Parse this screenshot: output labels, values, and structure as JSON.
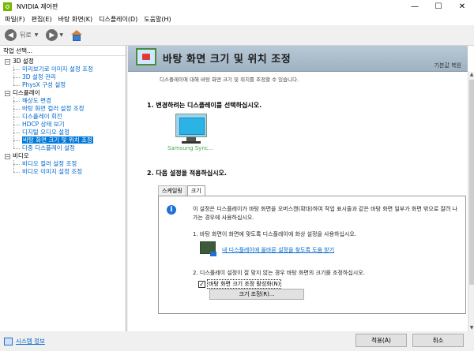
{
  "window": {
    "title": "NVIDIA 제어판",
    "controls": [
      "—",
      "☐",
      "✕"
    ]
  },
  "menu": [
    "파일(F)",
    "편집(E)",
    "바탕 화면(K)",
    "디스플레이(D)",
    "도움말(H)"
  ],
  "toolbar": {
    "back_label": "뒤로"
  },
  "sidebar": {
    "header": "작업 선택...",
    "categories": [
      {
        "label": "3D 설정",
        "toggle": "−",
        "items": [
          "미리보기로 이미지 설정 조정",
          "3D 설정 관리",
          "PhysX 구성 설정"
        ]
      },
      {
        "label": "디스플레이",
        "toggle": "−",
        "items": [
          "해상도 변경",
          "바탕 화면 컬러 설정 조정",
          "디스플레이 회전",
          "HDCP 상태 보기",
          "디지털 오디오 설정",
          "바탕 화면 크기 및 위치 조정",
          "다중 디스플레이 설정"
        ]
      },
      {
        "label": "비디오",
        "toggle": "−",
        "items": [
          "비디오 컬러 설정 조정",
          "비디오 이미지 설정 조정"
        ]
      }
    ],
    "selected": "바탕 화면 크기 및 위치 조정"
  },
  "system_info": "시스템 정보",
  "main": {
    "title": "바탕 화면 크기 및 위치 조정",
    "restore": "기본값 복원",
    "description": "디스플레이에 대해 바탕 화면 크기 및 위치를 조정할 수 있습니다.",
    "section1": "1. 변경하려는 디스플레이를 선택하십시오.",
    "display_name": "Samsung Sync...",
    "section2": "2. 다음 설정을 적용하십시오.",
    "tabs": [
      "스케일링",
      "크기"
    ],
    "active_tab": "크기",
    "info_text": "이 설정은 디스플레이가 바탕 화면을 오버스캔(확대)하여 작업 표시줄과 같은 바탕 화면 일부가 화면 밖으로 잘려 나가는 경우에 사용하십시오.",
    "step1": "1. 바탕 화면이 화면에 맞도록 디스플레이에 화상 설정을 사용하십시오.",
    "help_link": "내 디스플레이에 올바른 설정을 찾도록 도움 받기",
    "step2": "2. 디스플레이 설정이 잘 맞지 않는 경우 바탕 화면의 크기를 조정하십시오.",
    "checkbox_label": "바탕 화면 크기 조정 활성화(N)",
    "checkbox_checked": true,
    "resize_button": "크기 조정(R)..."
  },
  "buttons": {
    "apply": "적용(A)",
    "cancel": "취소"
  }
}
